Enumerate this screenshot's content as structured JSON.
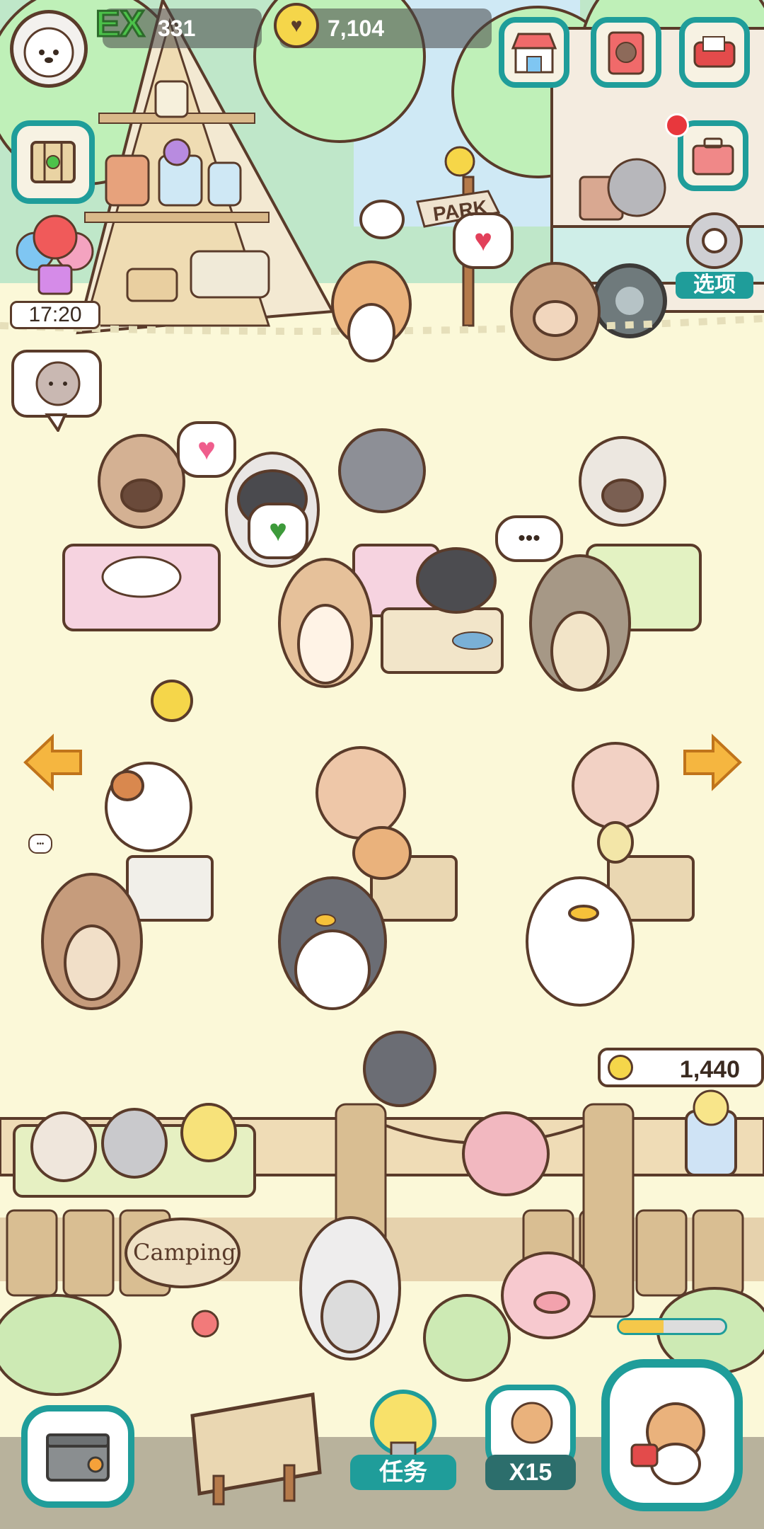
{
  "hud": {
    "level_badge": "EX",
    "level_value": "331",
    "coins": "7,104"
  },
  "timer": "17:20",
  "options_label": "选项",
  "bubbles": {
    "dots": "•••",
    "small_dots": "•••"
  },
  "camping_sign": "Camping",
  "park_sign": "PARK",
  "reward_coins": "1,440",
  "bottom": {
    "tasks_label": "任务",
    "multiplier_label": "X15"
  },
  "colors": {
    "accent": "#1f9d9a",
    "ground": "#fbf8d8",
    "outline": "#5a3b2a",
    "ex_green": "#4cc24a",
    "coin_yellow": "#f5d64a"
  },
  "icons": {
    "top_left": "dog-avatar-icon",
    "map": "map-icon",
    "balloon": "balloon-gift-icon",
    "cat_bubble": "cat-speech-icon",
    "shop": "shop-icon",
    "album": "album-icon",
    "mail": "mailbox-icon",
    "toolbox": "toolbox-icon",
    "gear": "gear-icon",
    "left_arrow": "arrow-left-icon",
    "right_arrow": "arrow-right-icon",
    "storage": "storage-box-icon",
    "signboard": "sign-board-icon",
    "lightbulb": "lightbulb-icon",
    "cat_card": "cat-card-icon",
    "megaphone_cat": "megaphone-cat-icon"
  }
}
